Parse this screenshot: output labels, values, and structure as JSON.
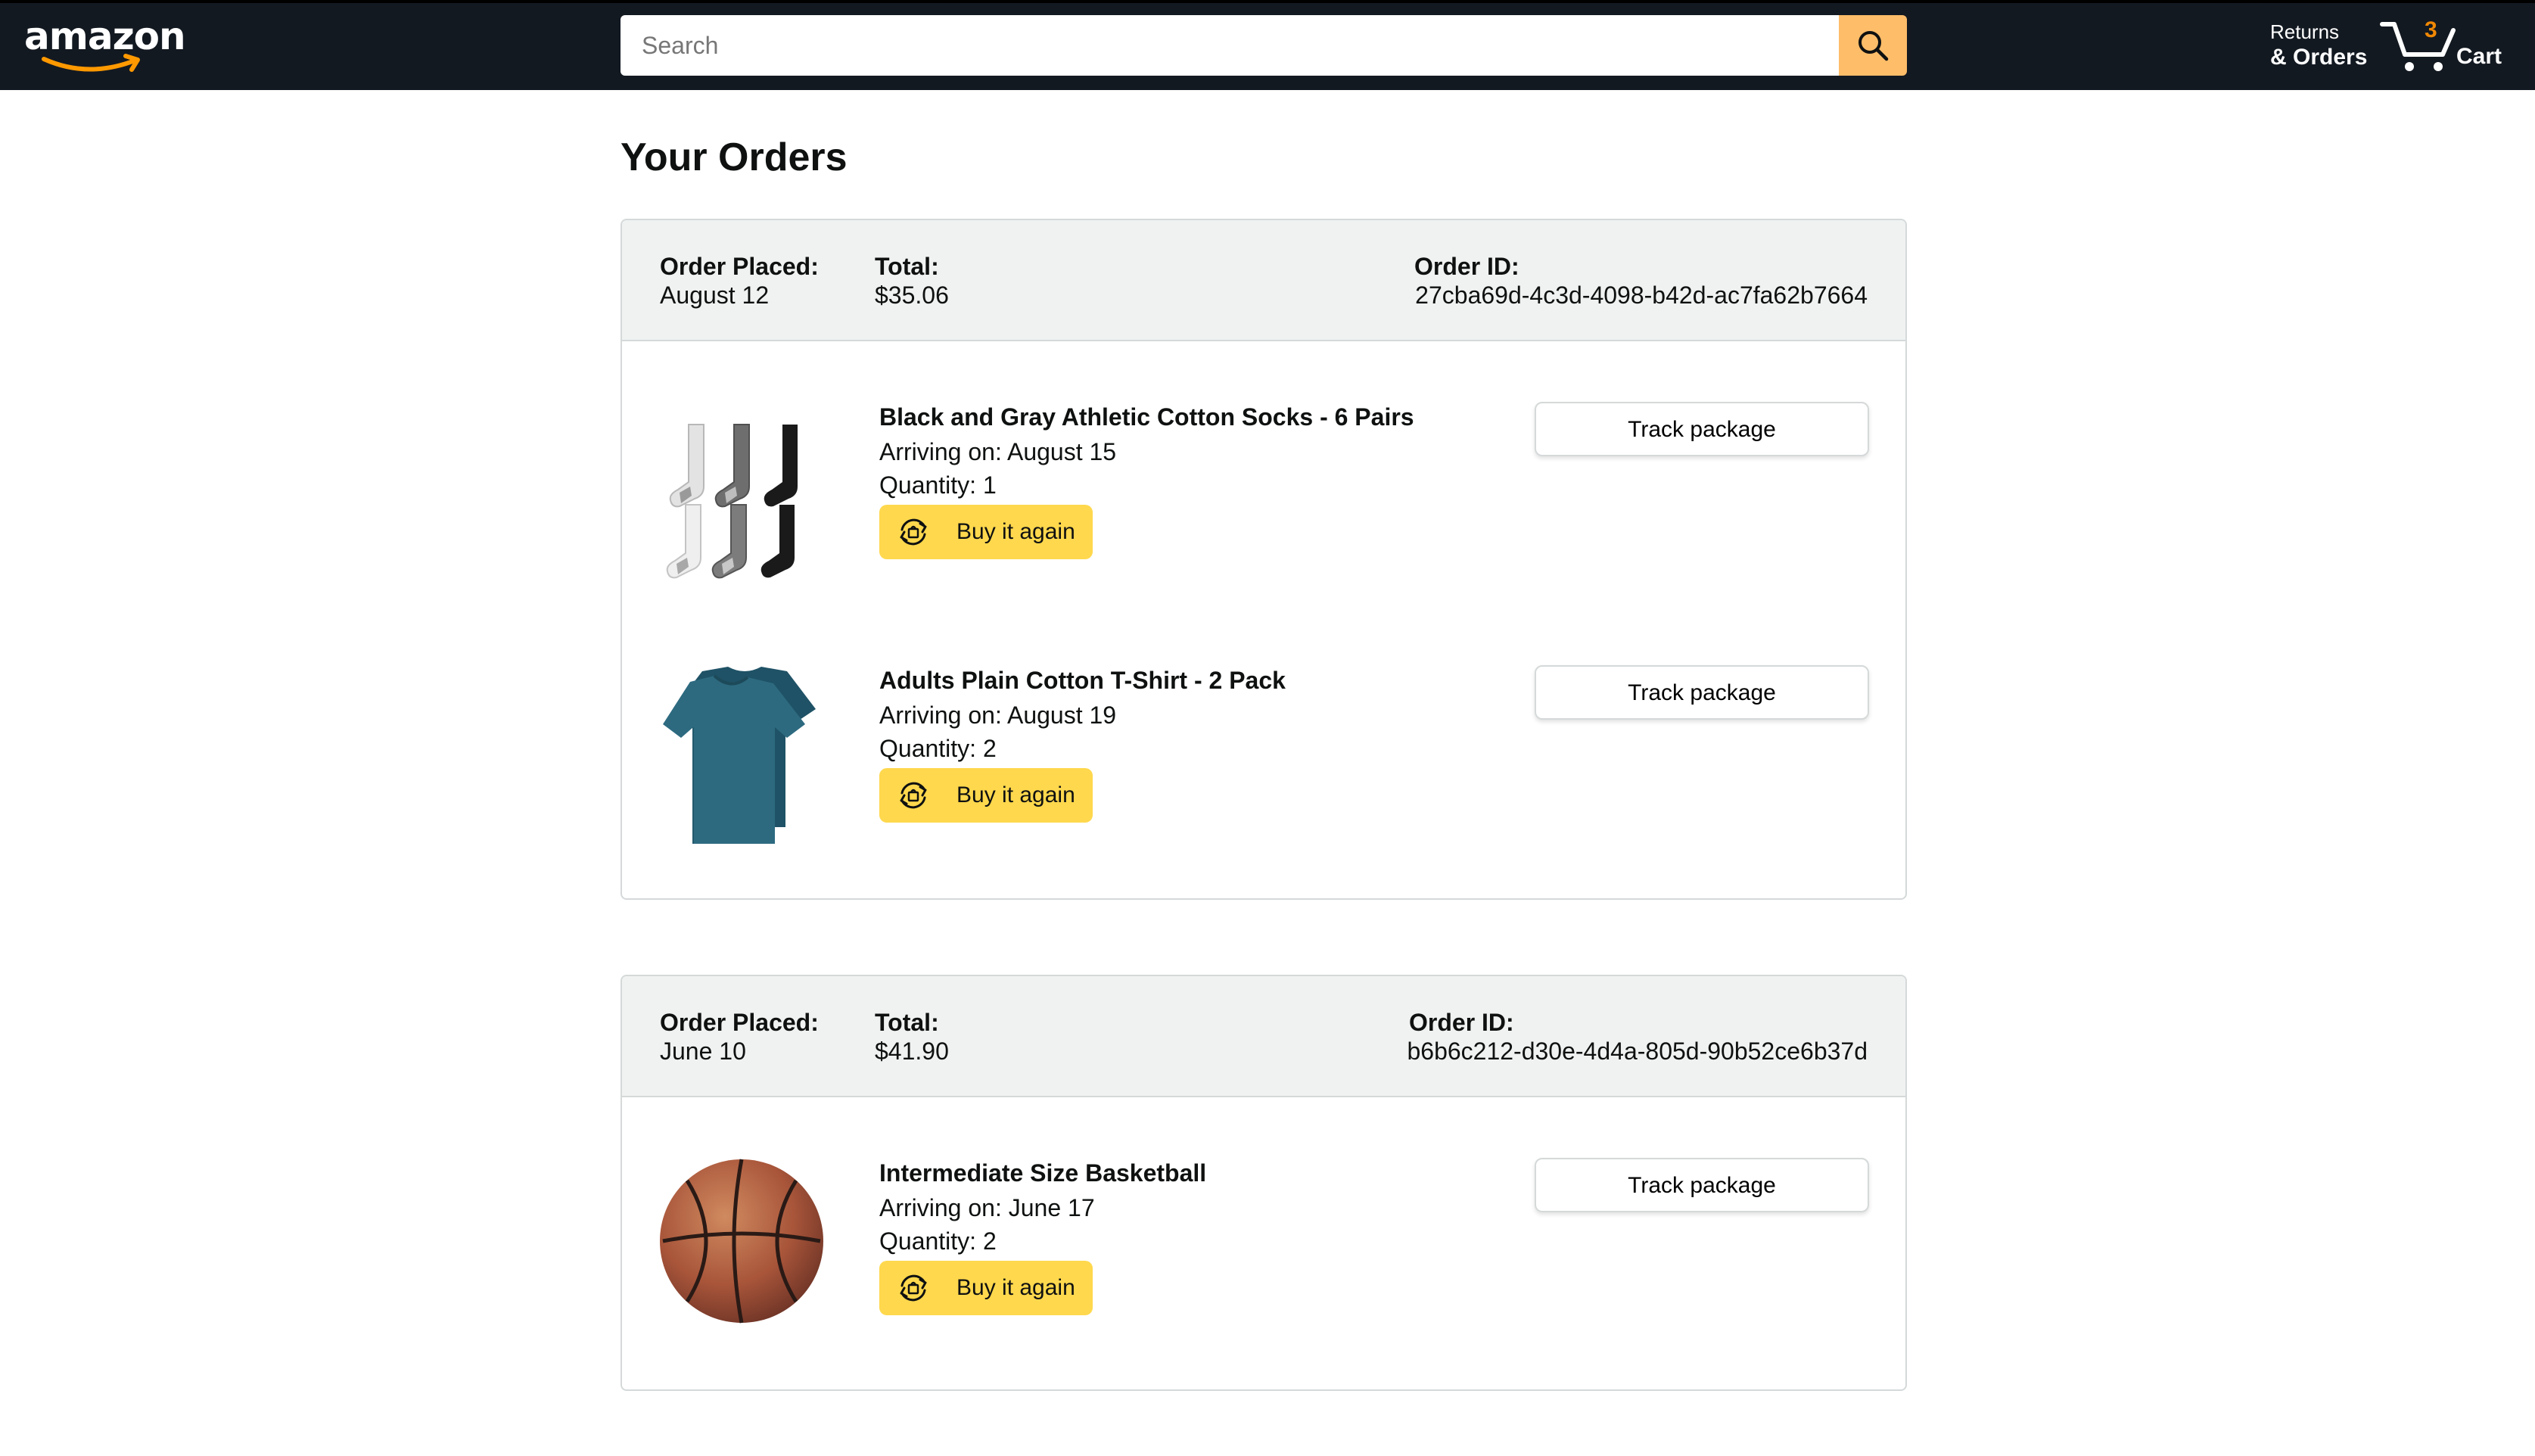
{
  "header": {
    "logo_text": "amazon",
    "search_placeholder": "Search",
    "returns_line1": "Returns",
    "returns_line2": "& Orders",
    "cart_count": "3",
    "cart_label": "Cart"
  },
  "page": {
    "title": "Your Orders"
  },
  "labels": {
    "order_placed": "Order Placed:",
    "total": "Total:",
    "order_id": "Order ID:",
    "buy_again": "Buy it again",
    "track_package": "Track package"
  },
  "orders": [
    {
      "date": "August 12",
      "total": "$35.06",
      "id": "27cba69d-4c3d-4098-b42d-ac7fa62b7664",
      "items": [
        {
          "name": "Black and Gray Athletic Cotton Socks - 6 Pairs",
          "arriving": "Arriving on: August 15",
          "quantity": "Quantity: 1",
          "image": "socks"
        },
        {
          "name": "Adults Plain Cotton T-Shirt - 2 Pack",
          "arriving": "Arriving on: August 19",
          "quantity": "Quantity: 2",
          "image": "t-shirt"
        }
      ]
    },
    {
      "date": "June 10",
      "total": "$41.90",
      "id": "b6b6c212-d30e-4d4a-805d-90b52ce6b37d",
      "items": [
        {
          "name": "Intermediate Size Basketball",
          "arriving": "Arriving on: June 17",
          "quantity": "Quantity: 2",
          "image": "basketball"
        }
      ]
    }
  ],
  "colors": {
    "header_bg": "#131921",
    "search_button": "#febd69",
    "cart_count": "#f08804",
    "buy_again_bg": "#ffd84d",
    "order_header_bg": "#f0f2f2",
    "border": "#d5d9d9"
  },
  "icons": {
    "search": "search-icon",
    "cart": "cart-icon",
    "buy_again": "buy-again-icon"
  }
}
